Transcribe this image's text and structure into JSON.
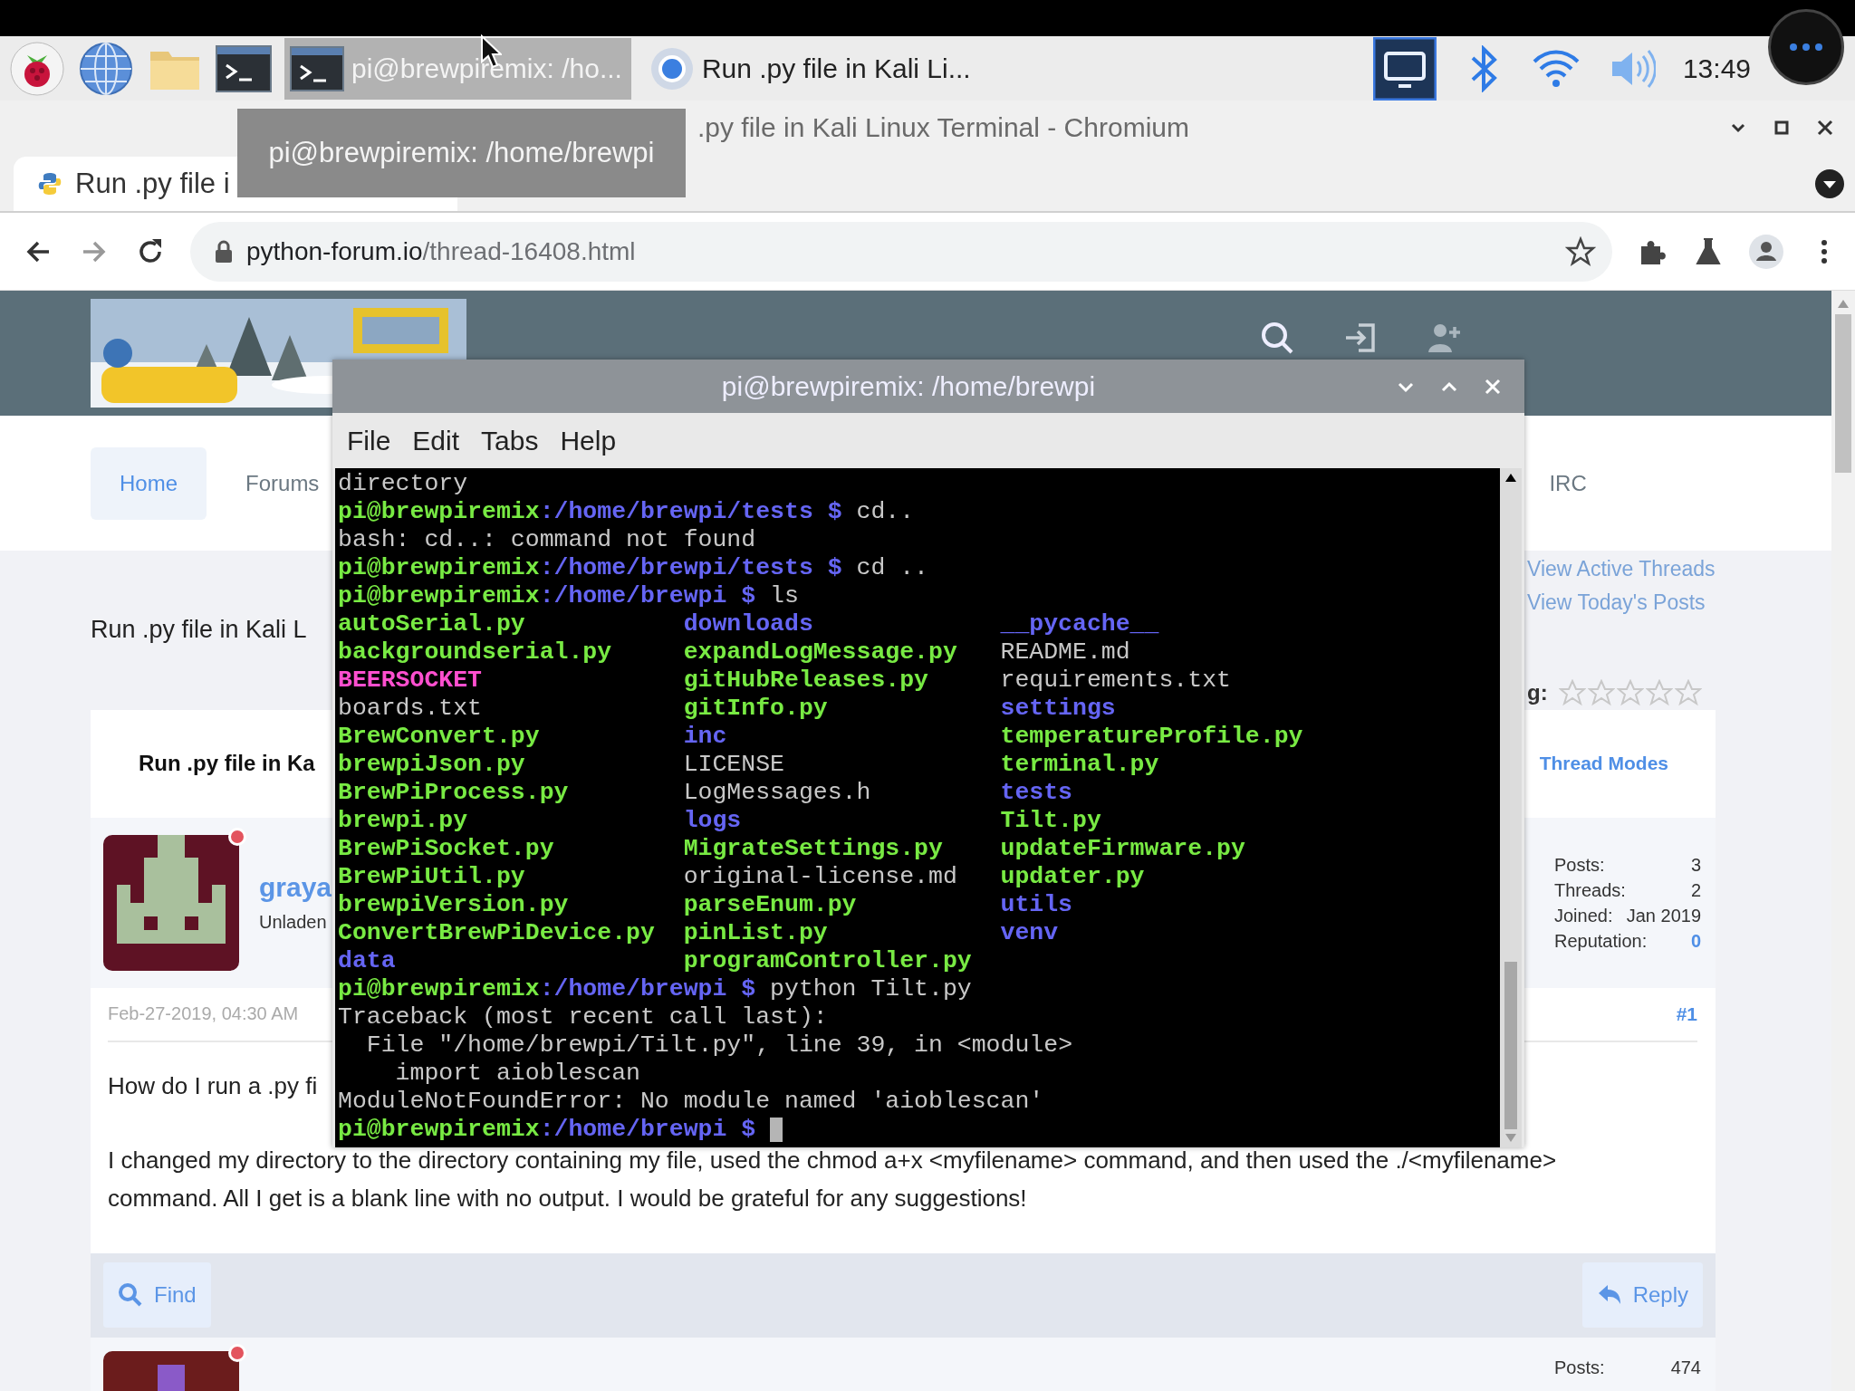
{
  "taskbar": {
    "tasks": [
      {
        "kind": "terminal",
        "label": "pi@brewpiremix: /ho...",
        "selected": true
      },
      {
        "kind": "browser",
        "label": "Run .py file in Kali Li...",
        "selected": false
      }
    ],
    "clock": "13:49"
  },
  "tooltip": "pi@brewpiremix: /home/brewpi",
  "browser": {
    "window_title": ".py file in Kali Linux Terminal - Chromium",
    "tab": "Run .py file i",
    "url_host": "python-forum.io",
    "url_path": "/thread-16408.html"
  },
  "forum": {
    "nav": [
      {
        "label": "Home",
        "selected": true
      },
      {
        "label": "Forums",
        "selected": false
      },
      {
        "label": "IRC",
        "selected": false
      }
    ],
    "links": [
      "View Active Threads",
      "View Today's Posts"
    ],
    "thread_title": "Run .py file in Kali L",
    "rating_label": "g:",
    "stars": 0,
    "card_title": "Run .py file in Ka",
    "thread_modes": "Thread Modes",
    "post": {
      "author": "graya",
      "rank": "Unladen",
      "online": true,
      "stats": [
        {
          "label": "Posts:",
          "value": "3",
          "kind": "text"
        },
        {
          "label": "Threads:",
          "value": "2",
          "kind": "text"
        },
        {
          "label": "Joined:",
          "value": "Jan 2019",
          "kind": "text"
        },
        {
          "label": "Reputation:",
          "value": "0",
          "kind": "link"
        }
      ],
      "date": "Feb-27-2019, 04:30 AM",
      "number": "#1",
      "body": [
        "How do I run a .py fi",
        "I changed my directory to the directory containing my file, used the chmod a+x <myfilename> command, and then used the ./<myfilename> command. All I get is a blank line with no output. I would be grateful for any suggestions!"
      ]
    },
    "actions": [
      {
        "kind": "find",
        "label": "Find"
      },
      {
        "kind": "reply",
        "label": "Reply"
      }
    ],
    "next_post": {
      "online": true,
      "stats": [
        {
          "label": "Posts:",
          "value": "474",
          "kind": "text"
        }
      ]
    }
  },
  "terminal": {
    "title": "pi@brewpiremix: /home/brewpi",
    "menu": [
      "File",
      "Edit",
      "Tabs",
      "Help"
    ],
    "lines": [
      {
        "kind": "text",
        "segments": [
          {
            "text": "directory",
            "kind": "plain"
          }
        ]
      },
      {
        "kind": "text",
        "segments": [
          {
            "text": "pi@brewpiremix",
            "kind": "user"
          },
          {
            "text": ":/home/brewpi/tests $",
            "kind": "path"
          },
          {
            "text": " cd..",
            "kind": "plain"
          }
        ]
      },
      {
        "kind": "text",
        "segments": [
          {
            "text": "bash: cd..: command not found",
            "kind": "plain"
          }
        ]
      },
      {
        "kind": "text",
        "segments": [
          {
            "text": "pi@brewpiremix",
            "kind": "user"
          },
          {
            "text": ":/home/brewpi/tests $",
            "kind": "path"
          },
          {
            "text": " cd ..",
            "kind": "plain"
          }
        ]
      },
      {
        "kind": "text",
        "segments": [
          {
            "text": "pi@brewpiremix",
            "kind": "user"
          },
          {
            "text": ":/home/brewpi $",
            "kind": "path"
          },
          {
            "text": " ls",
            "kind": "plain"
          }
        ]
      },
      {
        "kind": "listing",
        "cells": [
          {
            "text": "autoSerial.py",
            "kind": "exe"
          },
          {
            "text": "downloads",
            "kind": "dir"
          },
          {
            "text": "__pycache__",
            "kind": "dir"
          }
        ]
      },
      {
        "kind": "listing",
        "cells": [
          {
            "text": "backgroundserial.py",
            "kind": "exe"
          },
          {
            "text": "expandLogMessage.py",
            "kind": "exe"
          },
          {
            "text": "README.md",
            "kind": "plain"
          }
        ]
      },
      {
        "kind": "listing",
        "cells": [
          {
            "text": "BEERSOCKET",
            "kind": "socket"
          },
          {
            "text": "gitHubReleases.py",
            "kind": "exe"
          },
          {
            "text": "requirements.txt",
            "kind": "plain"
          }
        ]
      },
      {
        "kind": "listing",
        "cells": [
          {
            "text": "boards.txt",
            "kind": "plain"
          },
          {
            "text": "gitInfo.py",
            "kind": "exe"
          },
          {
            "text": "settings",
            "kind": "dir"
          }
        ]
      },
      {
        "kind": "listing",
        "cells": [
          {
            "text": "BrewConvert.py",
            "kind": "exe"
          },
          {
            "text": "inc",
            "kind": "dir"
          },
          {
            "text": "temperatureProfile.py",
            "kind": "exe"
          }
        ]
      },
      {
        "kind": "listing",
        "cells": [
          {
            "text": "brewpiJson.py",
            "kind": "exe"
          },
          {
            "text": "LICENSE",
            "kind": "plain"
          },
          {
            "text": "terminal.py",
            "kind": "exe"
          }
        ]
      },
      {
        "kind": "listing",
        "cells": [
          {
            "text": "BrewPiProcess.py",
            "kind": "exe"
          },
          {
            "text": "LogMessages.h",
            "kind": "plain"
          },
          {
            "text": "tests",
            "kind": "dir"
          }
        ]
      },
      {
        "kind": "listing",
        "cells": [
          {
            "text": "brewpi.py",
            "kind": "exe"
          },
          {
            "text": "logs",
            "kind": "dir"
          },
          {
            "text": "Tilt.py",
            "kind": "exe"
          }
        ]
      },
      {
        "kind": "listing",
        "cells": [
          {
            "text": "BrewPiSocket.py",
            "kind": "exe"
          },
          {
            "text": "MigrateSettings.py",
            "kind": "exe"
          },
          {
            "text": "updateFirmware.py",
            "kind": "exe"
          }
        ]
      },
      {
        "kind": "listing",
        "cells": [
          {
            "text": "BrewPiUtil.py",
            "kind": "exe"
          },
          {
            "text": "original-license.md",
            "kind": "plain"
          },
          {
            "text": "updater.py",
            "kind": "exe"
          }
        ]
      },
      {
        "kind": "listing",
        "cells": [
          {
            "text": "brewpiVersion.py",
            "kind": "exe"
          },
          {
            "text": "parseEnum.py",
            "kind": "exe"
          },
          {
            "text": "utils",
            "kind": "dir"
          }
        ]
      },
      {
        "kind": "listing",
        "cells": [
          {
            "text": "ConvertBrewPiDevice.py",
            "kind": "exe"
          },
          {
            "text": "pinList.py",
            "kind": "exe"
          },
          {
            "text": "venv",
            "kind": "dir"
          }
        ]
      },
      {
        "kind": "listing",
        "cells": [
          {
            "text": "data",
            "kind": "dir"
          },
          {
            "text": "programController.py",
            "kind": "exe"
          }
        ]
      },
      {
        "kind": "text",
        "segments": [
          {
            "text": "pi@brewpiremix",
            "kind": "user"
          },
          {
            "text": ":/home/brewpi $",
            "kind": "path"
          },
          {
            "text": " python Tilt.py",
            "kind": "plain"
          }
        ]
      },
      {
        "kind": "text",
        "segments": [
          {
            "text": "Traceback (most recent call last):",
            "kind": "plain"
          }
        ]
      },
      {
        "kind": "text",
        "segments": [
          {
            "text": "  File \"/home/brewpi/Tilt.py\", line 39, in <module>",
            "kind": "plain"
          }
        ]
      },
      {
        "kind": "text",
        "segments": [
          {
            "text": "    import aioblescan",
            "kind": "plain"
          }
        ]
      },
      {
        "kind": "text",
        "segments": [
          {
            "text": "ModuleNotFoundError: No module named 'aioblescan'",
            "kind": "plain"
          }
        ]
      },
      {
        "kind": "text",
        "cursor": true,
        "segments": [
          {
            "text": "pi@brewpiremix",
            "kind": "user"
          },
          {
            "text": ":/home/brewpi $",
            "kind": "path"
          }
        ]
      }
    ]
  }
}
